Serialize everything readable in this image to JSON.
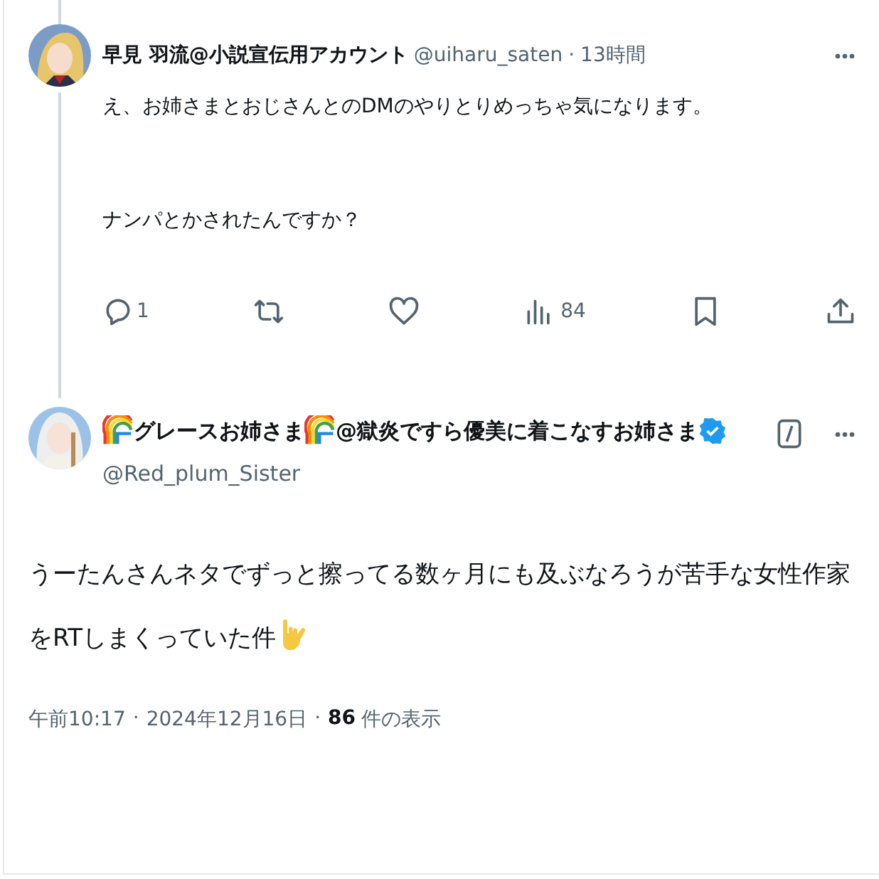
{
  "reply": {
    "name": "早見 羽流@小説宣伝用アカウント",
    "handle": "@uiharu_saten",
    "separator": "·",
    "time": "13時間",
    "paragraphs": [
      "え、お姉さまとおじさんとのDMのやりとりめっちゃ気になります。",
      "ナンパとかされたんですか？"
    ],
    "actions": [
      {
        "kind": "reply",
        "count": "1"
      },
      {
        "kind": "retweet"
      },
      {
        "kind": "like"
      },
      {
        "kind": "views",
        "count": "84"
      },
      {
        "kind": "bookmark"
      },
      {
        "kind": "share"
      }
    ]
  },
  "post": {
    "name_parts": [
      {
        "kind": "rainbow"
      },
      {
        "kind": "text",
        "text": "グレースお姉さま"
      },
      {
        "kind": "rainbow"
      },
      {
        "kind": "text",
        "text": "@獄炎ですら優美に着こなすお姉さま"
      }
    ],
    "verified": true,
    "handle": "@Red_plum_Sister",
    "body_parts": [
      {
        "kind": "text",
        "text": "うーたんさんネタでずっと擦ってる数ヶ月にも及ぶなろうが苦手な女性作家をRTしまくっていた件"
      },
      {
        "kind": "hand"
      }
    ],
    "time": "午前10:17",
    "separator_1": "·",
    "date": "2024年12月16日",
    "separator_2": "·",
    "views": "86",
    "views_label": "件の表示"
  }
}
